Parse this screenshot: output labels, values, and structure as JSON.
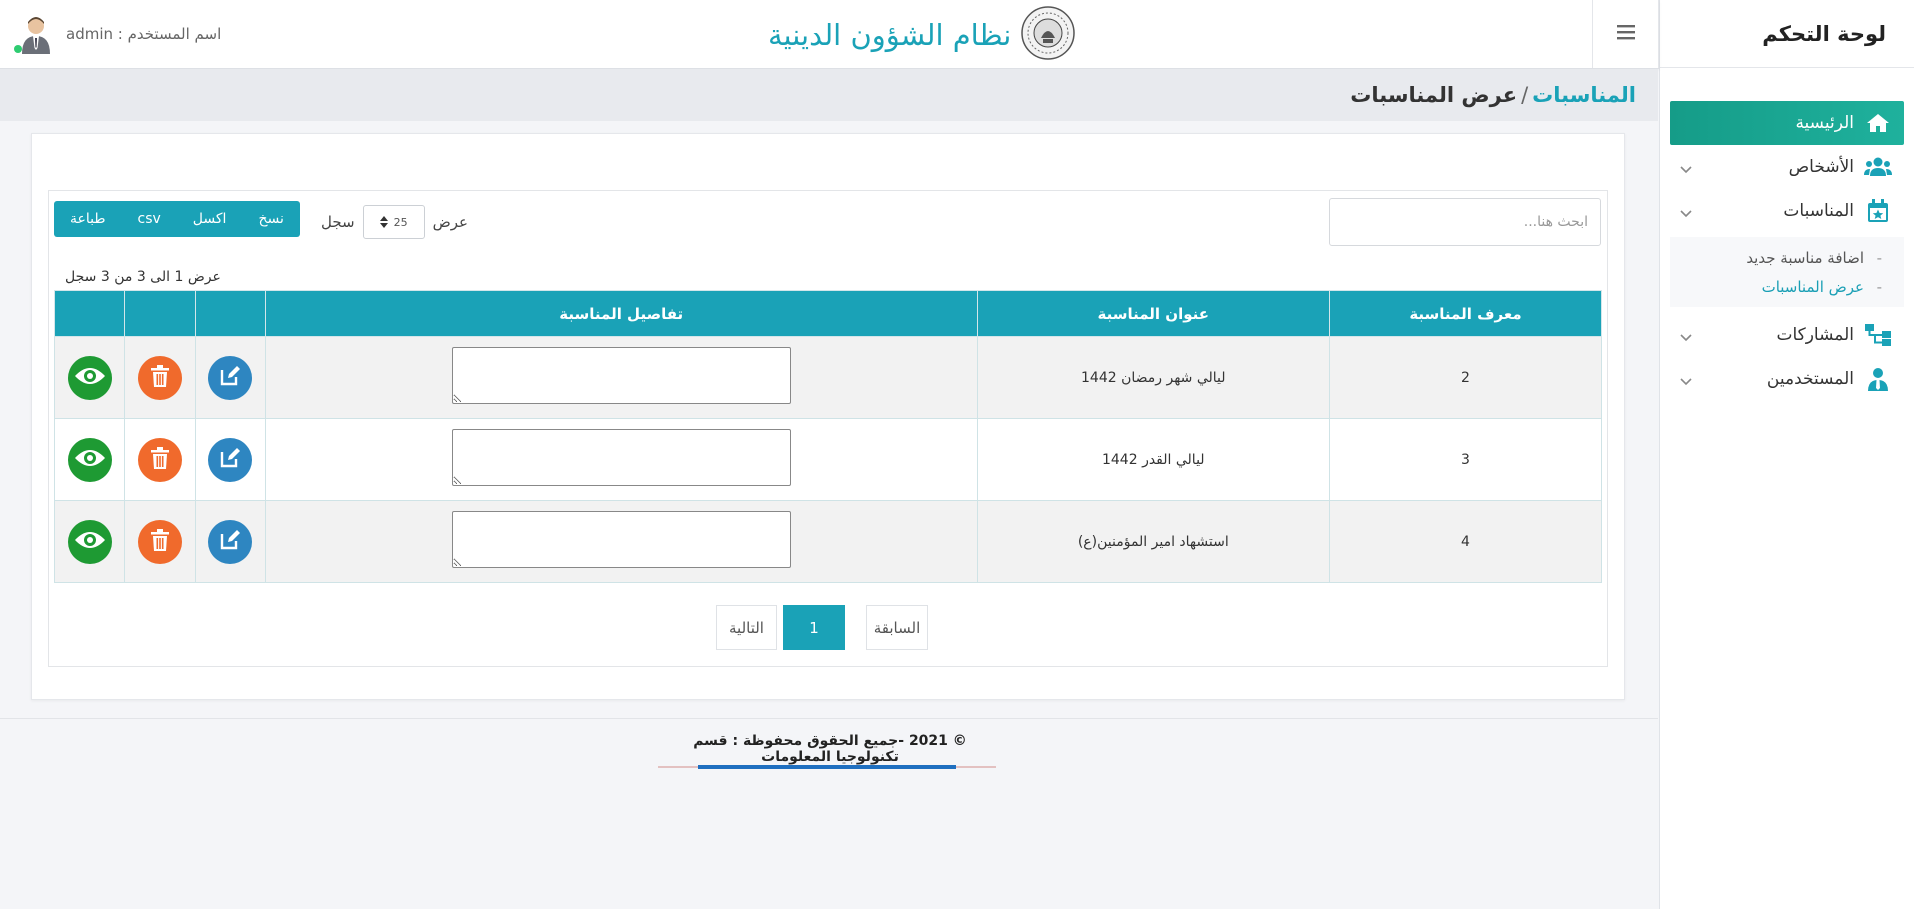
{
  "sidebar": {
    "brand": "لوحة التحكم",
    "items": [
      {
        "label": "الرئيسية",
        "icon": "home-icon"
      },
      {
        "label": "الأشخاص",
        "icon": "users-icon"
      },
      {
        "label": "المناسبات",
        "icon": "calendar-star-icon"
      },
      {
        "label": "المشاركات",
        "icon": "sitemap-icon"
      },
      {
        "label": "المستخدمين",
        "icon": "user-tie-icon"
      }
    ],
    "submenu": [
      {
        "label": "اضافة مناسبة جديد"
      },
      {
        "label": "عرض المناسبات"
      }
    ]
  },
  "header": {
    "system_title": "نظام الشؤون الدينية",
    "user_label": "اسم المستخدم : admin",
    "status_color": "#2ecc71"
  },
  "breadcrumb": {
    "parent": "المناسبات",
    "separator": "/",
    "current": "عرض المناسبات"
  },
  "toolbar": {
    "search_placeholder": "ابحث هنا...",
    "show_label": "عرض",
    "records_label": "سجل",
    "page_length": "25",
    "buttons": {
      "copy": "نسخ",
      "excel": "اكسل",
      "csv": "csv",
      "print": "طباعة"
    }
  },
  "table": {
    "info": "عرض 1 الى 3 من 3 سجل",
    "headers": {
      "id": "معرف المناسبة",
      "title": "عنوان المناسبة",
      "details": "تفاصيل المناسبة"
    },
    "rows": [
      {
        "id": "2",
        "title": "ليالي شهر رمضان 1442"
      },
      {
        "id": "3",
        "title": "ليالي القدر 1442"
      },
      {
        "id": "4",
        "title": "استشهاد امير المؤمنين(ع)"
      }
    ]
  },
  "pagination": {
    "previous": "السابقة",
    "current": "1",
    "next": "التالية"
  },
  "footer": {
    "text": "© 2021 -جميع الحقوق محفوظة : قسم تكنولوجيا المعلومات"
  },
  "colors": {
    "accent": "#1aa2b7",
    "sidebar_active": "#1fb19d",
    "edit": "#2e86c1",
    "delete": "#f06a2c",
    "view": "#1e9a33"
  }
}
